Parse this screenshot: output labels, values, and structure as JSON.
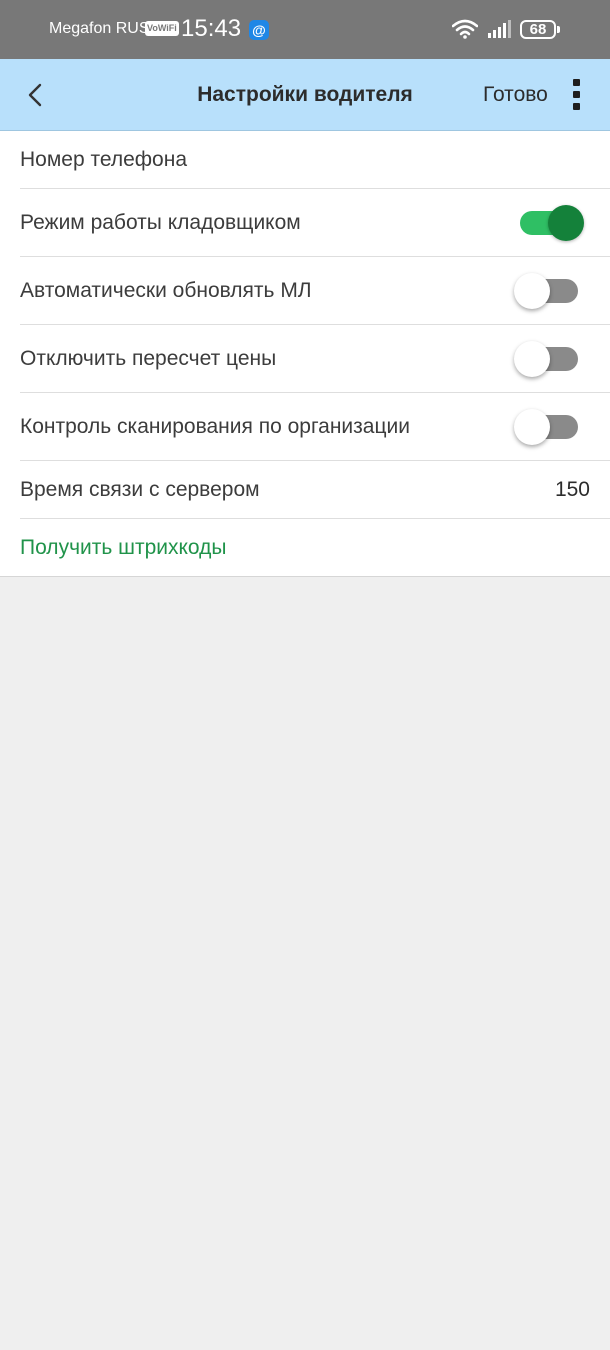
{
  "status_bar": {
    "carrier": "Megafon RUS",
    "vowifi": "VoWiFi",
    "time": "15:43",
    "notification_icon": "at-sign-icon",
    "battery": "68"
  },
  "appbar": {
    "title": "Настройки водителя",
    "done_label": "Готово"
  },
  "settings": [
    {
      "label": "Номер телефона"
    },
    {
      "label": "Режим работы кладовщиком",
      "toggle": true
    },
    {
      "label": "Автоматически обновлять МЛ",
      "toggle": false
    },
    {
      "label": "Отключить пересчет цены",
      "toggle": false
    },
    {
      "label": "Контроль сканирования по организации",
      "toggle": false
    },
    {
      "label": "Время связи с сервером",
      "value": "150"
    },
    {
      "label": "Получить штрихкоды"
    }
  ],
  "colors": {
    "accent_green": "#20934a",
    "appbar_bg": "#b8e0fb",
    "toggle_on": "#14813a"
  }
}
